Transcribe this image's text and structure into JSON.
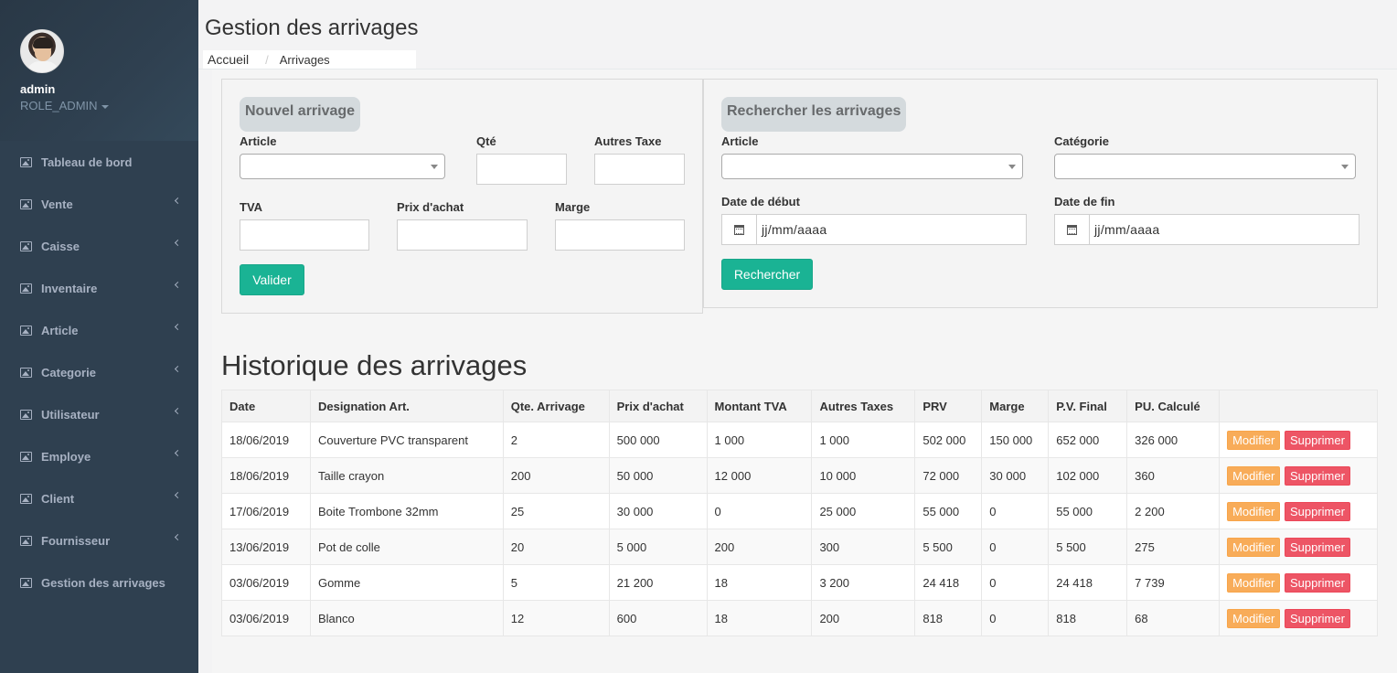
{
  "sidebar": {
    "user_name": "admin",
    "user_role": "ROLE_ADMIN",
    "items": [
      {
        "label": "Tableau de bord",
        "icon": "image-icon",
        "has_chevron": false
      },
      {
        "label": "Vente",
        "icon": "image-icon",
        "has_chevron": true
      },
      {
        "label": "Caisse",
        "icon": "image-icon",
        "has_chevron": true
      },
      {
        "label": "Inventaire",
        "icon": "image-icon",
        "has_chevron": true
      },
      {
        "label": "Article",
        "icon": "image-icon",
        "has_chevron": true
      },
      {
        "label": "Categorie",
        "icon": "image-icon",
        "has_chevron": true
      },
      {
        "label": "Utilisateur",
        "icon": "image-icon",
        "has_chevron": true
      },
      {
        "label": "Employe",
        "icon": "image-icon",
        "has_chevron": true
      },
      {
        "label": "Client",
        "icon": "image-icon",
        "has_chevron": true
      },
      {
        "label": "Fournisseur",
        "icon": "image-icon",
        "has_chevron": true
      },
      {
        "label": "Gestion des arrivages",
        "icon": "image-icon",
        "has_chevron": false
      }
    ]
  },
  "header": {
    "title": "Gestion des arrivages",
    "breadcrumb_home": "Accueil",
    "breadcrumb_sep": "/",
    "breadcrumb_current": "Arrivages"
  },
  "new_form": {
    "title": "Nouvel arrivage",
    "article_label": "Article",
    "qte_label": "Qté",
    "autres_taxe_label": "Autres Taxe",
    "tva_label": "TVA",
    "prix_achat_label": "Prix d'achat",
    "marge_label": "Marge",
    "submit_label": "Valider"
  },
  "search_form": {
    "title": "Rechercher les arrivages",
    "article_label": "Article",
    "categorie_label": "Catégorie",
    "date_debut_label": "Date de début",
    "date_fin_label": "Date de fin",
    "date_placeholder": "jj/mm/aaaa",
    "submit_label": "Rechercher"
  },
  "history": {
    "title": "Historique des arrivages",
    "columns": [
      "Date",
      "Designation Art.",
      "Qte. Arrivage",
      "Prix d'achat",
      "Montant TVA",
      "Autres Taxes",
      "PRV",
      "Marge",
      "P.V. Final",
      "PU. Calculé",
      ""
    ],
    "modify_label": "Modifier",
    "delete_label": "Supprimer",
    "rows": [
      [
        "18/06/2019",
        "Couverture PVC transparent",
        "2",
        "500 000",
        "1 000",
        "1 000",
        "502 000",
        "150 000",
        "652 000",
        "326 000"
      ],
      [
        "18/06/2019",
        "Taille crayon",
        "200",
        "50 000",
        "12 000",
        "10 000",
        "72 000",
        "30 000",
        "102 000",
        "360"
      ],
      [
        "17/06/2019",
        "Boite Trombone 32mm",
        "25",
        "30 000",
        "0",
        "25 000",
        "55 000",
        "0",
        "55 000",
        "2 200"
      ],
      [
        "13/06/2019",
        "Pot de colle",
        "20",
        "5 000",
        "200",
        "300",
        "5 500",
        "0",
        "5 500",
        "275"
      ],
      [
        "03/06/2019",
        "Gomme",
        "5",
        "21 200",
        "18",
        "3 200",
        "24 418",
        "0",
        "24 418",
        "7 739"
      ],
      [
        "03/06/2019",
        "Blanco",
        "12",
        "600",
        "18",
        "200",
        "818",
        "0",
        "818",
        "68"
      ]
    ]
  },
  "colors": {
    "sidebar_bg": "#2f4050",
    "primary_green": "#1ab394",
    "warning_orange": "#f8ac59",
    "danger_red": "#ed5565"
  }
}
